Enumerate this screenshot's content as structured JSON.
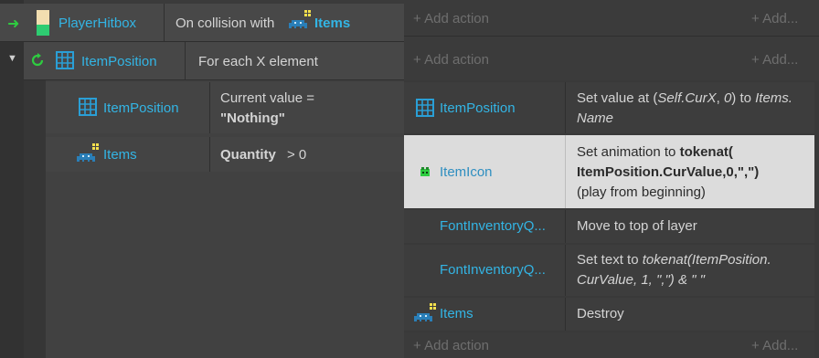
{
  "event": {
    "object": "PlayerHitbox",
    "condition_text": "On collision with",
    "condition_target": "Items",
    "add_action": "+ Add action",
    "add_more": "+ Add..."
  },
  "sub_event": {
    "object": "ItemPosition",
    "condition_text": "For each X element",
    "add_action": "+ Add action",
    "add_more": "+ Add..."
  },
  "conditions": [
    {
      "object": "ItemPosition",
      "text_prefix": "Current value =",
      "text_value": "\"Nothing\""
    },
    {
      "object": "Items",
      "text_bold": "Quantity",
      "text_rest": "> 0"
    }
  ],
  "actions": [
    {
      "object": "ItemPosition",
      "p1": "Set value at (",
      "p2": "Self.CurX",
      "p3": ", ",
      "p4": "0",
      "p5": ") to ",
      "p6": "Items.",
      "line2": "Name"
    },
    {
      "object": "ItemIcon",
      "line1a": "Set animation to ",
      "line1b": "tokenat(",
      "line2": "ItemPosition.CurValue,0,\",\")",
      "line3": "(play from beginning)"
    },
    {
      "object": "FontInventoryQ...",
      "text": "Move to top of layer"
    },
    {
      "object": "FontInventoryQ...",
      "line1a": "Set text to ",
      "line1b": "tokenat(ItemPosition.",
      "line2": "CurValue, 1, \",\") & \" \""
    },
    {
      "object": "Items",
      "text": "Destroy"
    }
  ],
  "bottom": {
    "add_action": "+ Add action",
    "add_more": "+ Add..."
  },
  "colors": {
    "accent_cyan": "#33b5e5",
    "green_arrow": "#2ecc40",
    "selected_row": "#dcdcdc"
  }
}
